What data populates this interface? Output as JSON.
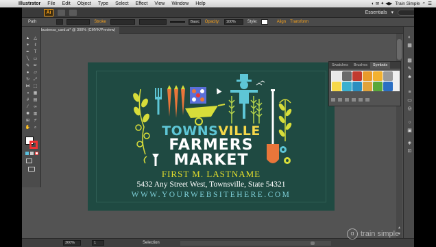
{
  "menubar": {
    "apple": "",
    "items": [
      "Illustrator",
      "File",
      "Edit",
      "Object",
      "Type",
      "Select",
      "Effect",
      "View",
      "Window",
      "Help"
    ],
    "right_text": "Train Simple"
  },
  "appbar": {
    "logo": "Ai",
    "workspace": "Essentials"
  },
  "controlbar": {
    "selection_label": "Path",
    "stroke_label": "Stroke",
    "stroke_profile": "Basic",
    "opacity_label": "Opacity:",
    "opacity_value": "100%",
    "style_label": "Style:",
    "align_label": "Align",
    "transform_label": "Transform"
  },
  "document": {
    "tab_title": "business_card.ai* @ 300% (CMYK/Preview)"
  },
  "card": {
    "title_part1": "TOWNS",
    "title_part2": "VILLE",
    "line2": "FARMERS",
    "line3": "MARKET",
    "name": "FIRST M. LASTNAME",
    "address": "5432 Any Street West, Townsville, State 54321",
    "website": "WWW.YOURWEBSITEHERE.COM"
  },
  "symbols_panel": {
    "tabs": [
      "Swatches",
      "Brushes",
      "Symbols"
    ],
    "active_tab": "Symbols"
  },
  "statusbar": {
    "zoom": "300%",
    "page": "1",
    "mode": "Selection"
  },
  "watermark": {
    "text": "train simple"
  },
  "colors": {
    "card_bg": "#1f4a42",
    "teal": "#5ec6d6",
    "yellow": "#f6d84a",
    "orange": "#e9763a",
    "ai_orange": "#f7a21c"
  }
}
